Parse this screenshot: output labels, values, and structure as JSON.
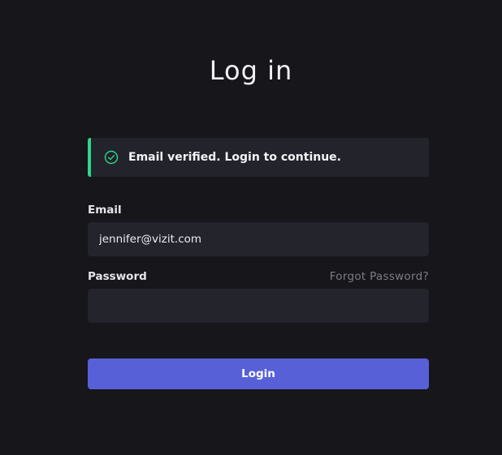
{
  "page": {
    "title": "Log in"
  },
  "alert": {
    "icon": "check-circle-icon",
    "message": "Email verified. Login to continue.",
    "accent_color": "#2fd58c"
  },
  "form": {
    "email": {
      "label": "Email",
      "value": "jennifer@vizit.com"
    },
    "password": {
      "label": "Password",
      "value": "",
      "forgot_link": "Forgot Password?"
    },
    "submit_label": "Login",
    "submit_color": "#5760d6"
  }
}
